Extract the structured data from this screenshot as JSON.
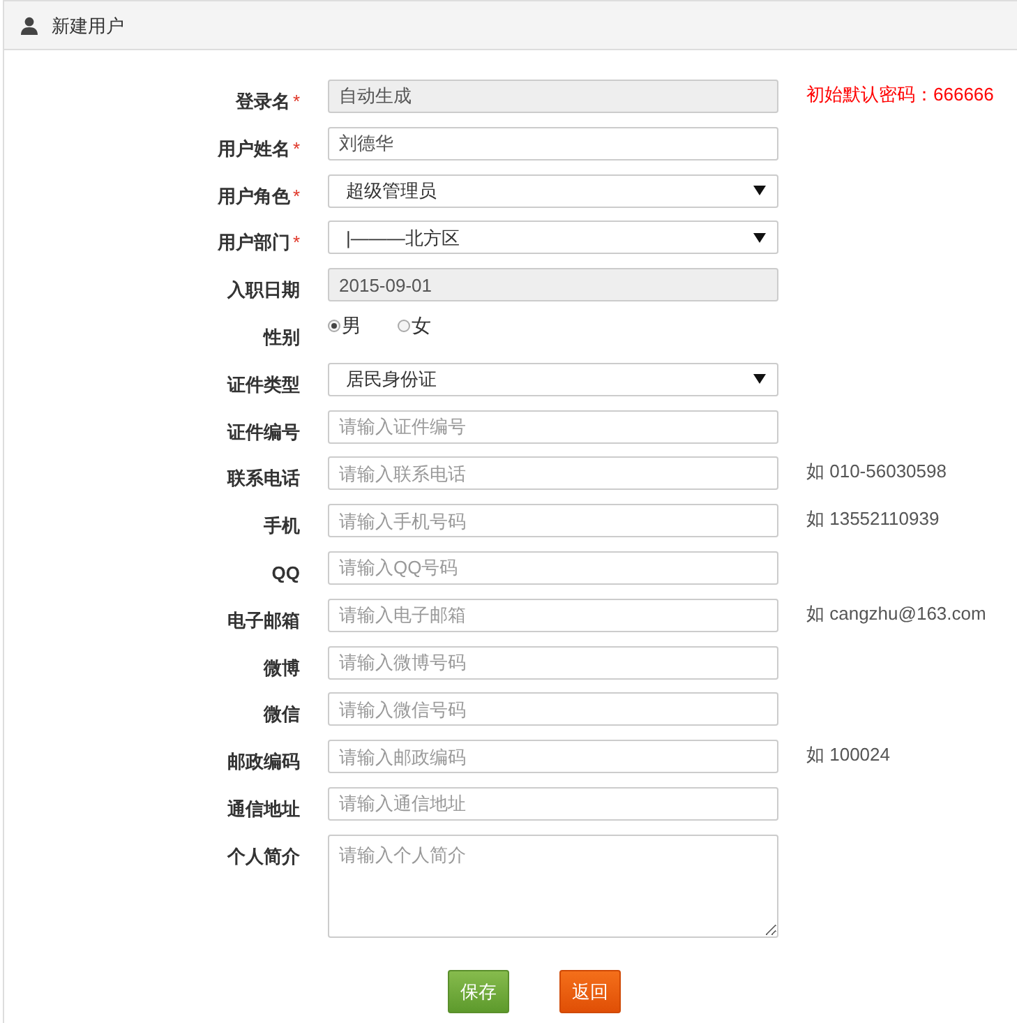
{
  "panel": {
    "title": "新建用户"
  },
  "fields": [
    {
      "label": "登录名",
      "required_mark": "*",
      "kind": "readonly",
      "value": "自动生成",
      "hint": {
        "text": "初始默认密码：666666",
        "kind": "warning"
      }
    },
    {
      "label": "用户姓名",
      "required_mark": "*",
      "kind": "text",
      "value": "刘德华"
    },
    {
      "label": "用户角色",
      "required_mark": "*",
      "kind": "select",
      "value": "超级管理员"
    },
    {
      "label": "用户部门",
      "required_mark": "*",
      "kind": "select",
      "value": "|———北方区"
    },
    {
      "label": "入职日期",
      "kind": "readonly",
      "value": "2015-09-01"
    },
    {
      "label": "性别",
      "kind": "radio",
      "options": [
        {
          "label": "男",
          "selected": true
        },
        {
          "label": "女",
          "selected": false
        }
      ]
    },
    {
      "label": "证件类型",
      "kind": "select",
      "value": "居民身份证"
    },
    {
      "label": "证件编号",
      "kind": "text",
      "placeholder": "请输入证件编号"
    },
    {
      "label": "联系电话",
      "kind": "text",
      "placeholder": "请输入联系电话",
      "hint": {
        "text": "如 010-56030598",
        "kind": "example"
      }
    },
    {
      "label": "手机",
      "kind": "text",
      "placeholder": "请输入手机号码",
      "hint": {
        "text": "如 13552110939",
        "kind": "example"
      }
    },
    {
      "label": "QQ",
      "kind": "text",
      "placeholder": "请输入QQ号码"
    },
    {
      "label": "电子邮箱",
      "kind": "text",
      "placeholder": "请输入电子邮箱",
      "hint": {
        "text": "如 cangzhu@163.com",
        "kind": "example"
      }
    },
    {
      "label": "微博",
      "kind": "text",
      "placeholder": "请输入微博号码"
    },
    {
      "label": "微信",
      "kind": "text",
      "placeholder": "请输入微信号码"
    },
    {
      "label": "邮政编码",
      "kind": "text",
      "placeholder": "请输入邮政编码",
      "hint": {
        "text": "如 100024",
        "kind": "example"
      }
    },
    {
      "label": "通信地址",
      "kind": "text",
      "placeholder": "请输入通信地址"
    },
    {
      "label": "个人简介",
      "kind": "textarea",
      "placeholder": "请输入个人简介"
    }
  ],
  "buttons": [
    {
      "label": "保存",
      "kind": "primary"
    },
    {
      "label": "返回",
      "kind": "cancel"
    }
  ]
}
